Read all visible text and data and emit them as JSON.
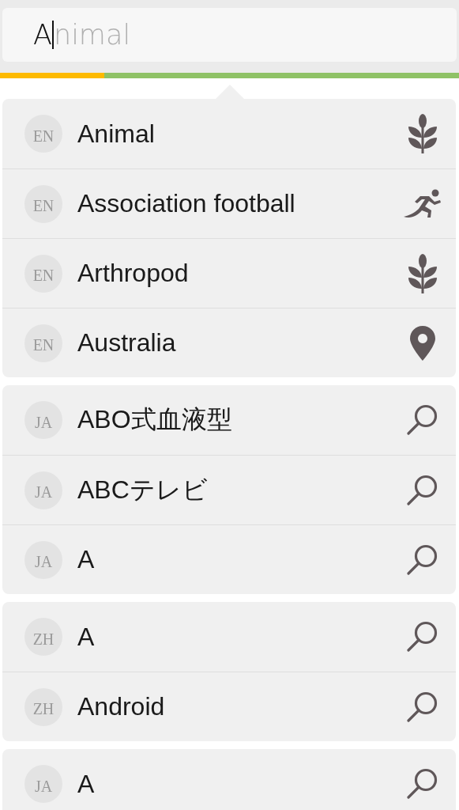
{
  "search": {
    "value": "A",
    "completion": "nimal"
  },
  "progress": {
    "level": 0.227
  },
  "groups": [
    {
      "items": [
        {
          "lang": "EN",
          "label": "Animal",
          "kind": "plant"
        },
        {
          "lang": "EN",
          "label": "Association football",
          "kind": "runner"
        },
        {
          "lang": "EN",
          "label": "Arthropod",
          "kind": "plant"
        },
        {
          "lang": "EN",
          "label": "Australia",
          "kind": "place"
        }
      ]
    },
    {
      "items": [
        {
          "lang": "JA",
          "label": "ABO式血液型",
          "kind": "query"
        },
        {
          "lang": "JA",
          "label": "ABCテレビ",
          "kind": "query"
        },
        {
          "lang": "JA",
          "label": "A",
          "kind": "query"
        }
      ]
    },
    {
      "items": [
        {
          "lang": "ZH",
          "label": "A",
          "kind": "query"
        },
        {
          "lang": "ZH",
          "label": "Android",
          "kind": "query"
        }
      ]
    },
    {
      "items": [
        {
          "lang": "JA",
          "label": "A",
          "kind": "query"
        }
      ]
    }
  ]
}
